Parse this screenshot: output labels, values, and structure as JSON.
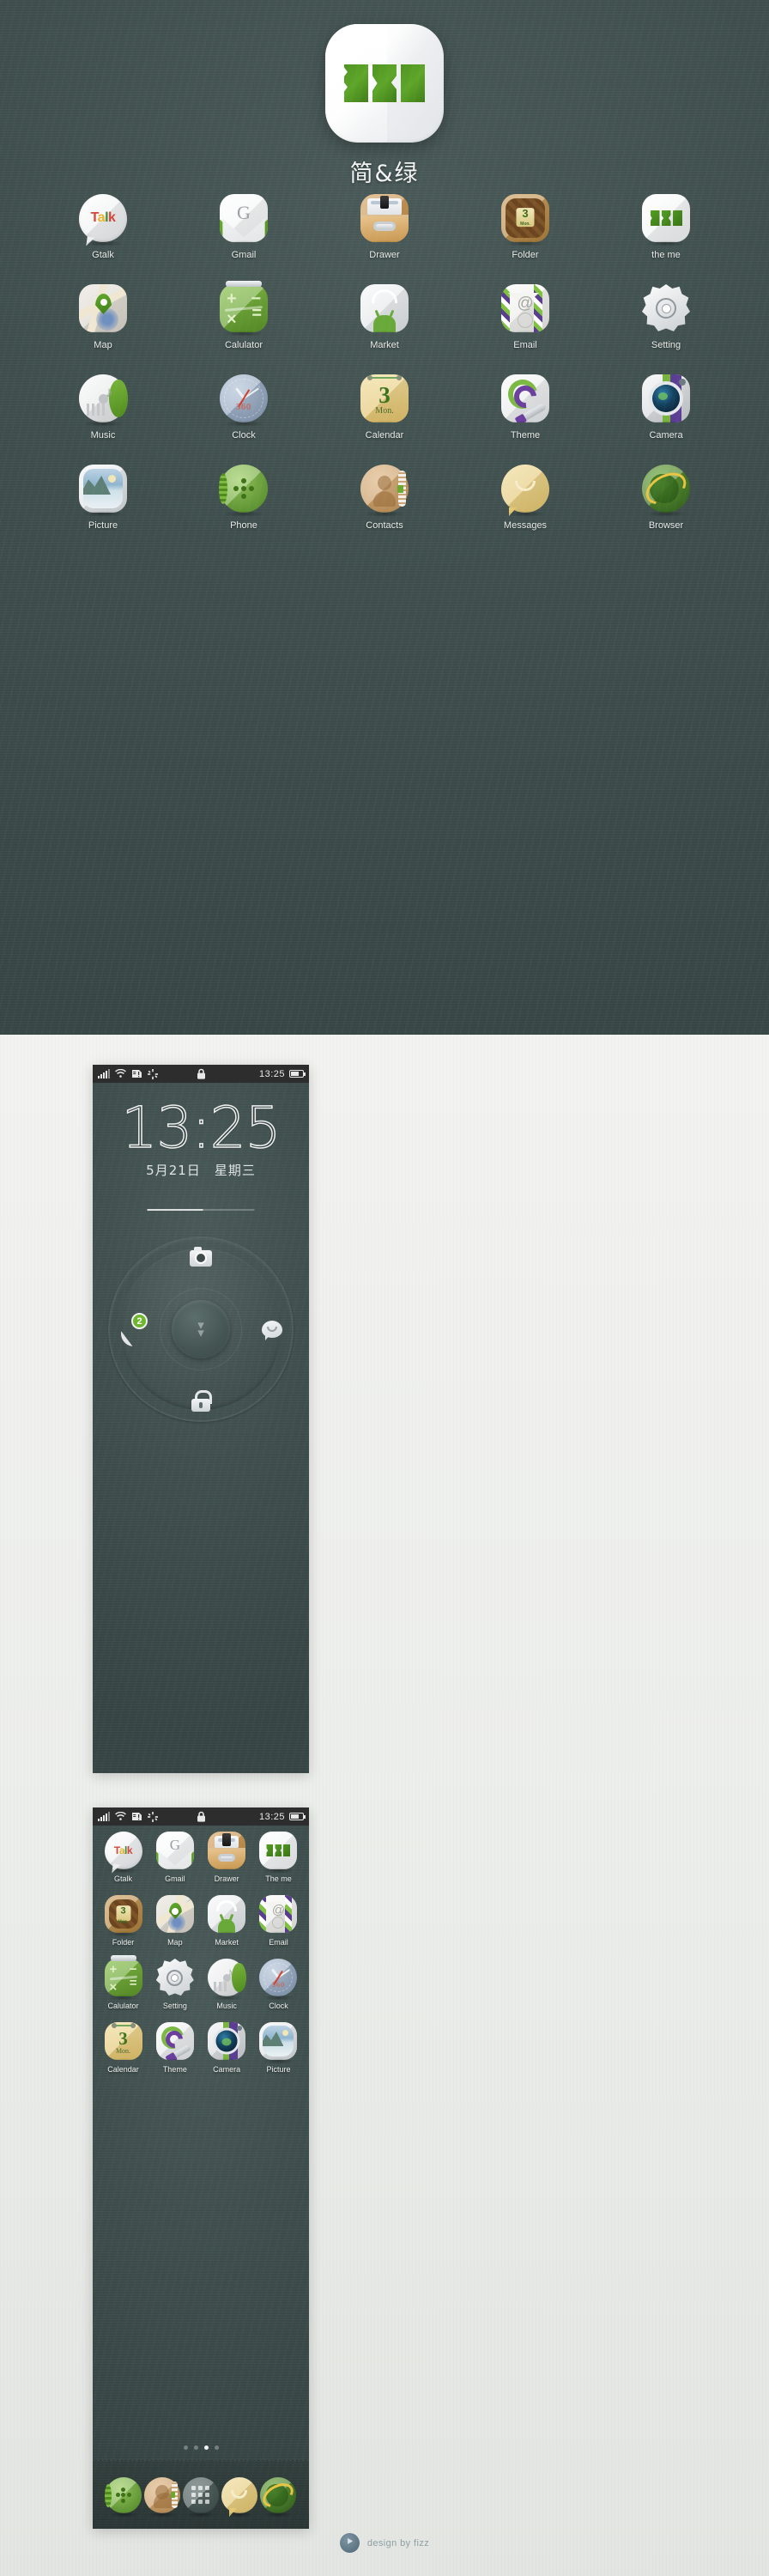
{
  "hero": {
    "app_title": "简&绿",
    "logo_icon": "jian-lv-logo-icon",
    "icon_rows": [
      [
        {
          "label": "Gtalk",
          "icon": "gtalk-icon",
          "talk": [
            "T",
            "a",
            "l",
            "k"
          ]
        },
        {
          "label": "Gmail",
          "icon": "gmail-icon",
          "letter": "G"
        },
        {
          "label": "Drawer",
          "icon": "drawer-icon"
        },
        {
          "label": "Folder",
          "icon": "folder-icon",
          "day": "3",
          "weekday": "Mon."
        },
        {
          "label": "the  me",
          "icon": "theme-logo-icon"
        }
      ],
      [
        {
          "label": "Map",
          "icon": "map-icon"
        },
        {
          "label": "Calulator",
          "icon": "calculator-icon",
          "ops": [
            "+",
            "−",
            "×",
            "="
          ]
        },
        {
          "label": "Market",
          "icon": "market-icon"
        },
        {
          "label": "Email",
          "icon": "email-icon",
          "at": "@"
        },
        {
          "label": "Setting",
          "icon": "setting-gear-icon"
        }
      ],
      [
        {
          "label": "Music",
          "icon": "music-disc-icon",
          "note": "♪"
        },
        {
          "label": "Clock",
          "icon": "clock-icon",
          "dial_text": "360"
        },
        {
          "label": "Calendar",
          "icon": "calendar-icon",
          "day": "3",
          "weekday": "Mon."
        },
        {
          "label": "Theme",
          "icon": "theme-brush-icon"
        },
        {
          "label": "Camera",
          "icon": "camera-icon"
        }
      ],
      [
        {
          "label": "Picture",
          "icon": "picture-icon"
        },
        {
          "label": "Phone",
          "icon": "phone-icon"
        },
        {
          "label": "Contacts",
          "icon": "contacts-icon"
        },
        {
          "label": "Messages",
          "icon": "messages-icon"
        },
        {
          "label": "Browser",
          "icon": "browser-globe-icon"
        }
      ]
    ]
  },
  "statusbar": {
    "signal_icon": "signal-bars-icon",
    "wifi_icon": "wifi-icon",
    "sim_icon": "sim-alert-icon",
    "sync_icon": "sync-spinner-icon",
    "lock_icon": "lock-icon",
    "time": "13:25",
    "battery_icon": "battery-icon"
  },
  "lockscreen": {
    "time": "13:25",
    "date": "5月21日",
    "weekday": "星期三",
    "ring": {
      "top": {
        "name": "camera-shortcut",
        "icon": "camera-icon"
      },
      "left": {
        "name": "phone-shortcut",
        "icon": "phone-handset-icon",
        "badge": "2"
      },
      "right": {
        "name": "messages-shortcut",
        "icon": "message-bubble-icon"
      },
      "bottom": {
        "name": "unlock-shortcut",
        "icon": "padlock-icon"
      },
      "center": {
        "name": "unlock-handle",
        "icon": "chevron-double-down-icon"
      }
    }
  },
  "drawer": {
    "rows": [
      [
        {
          "label": "Gtalk",
          "icon": "gtalk-icon",
          "talk": [
            "T",
            "a",
            "l",
            "k"
          ]
        },
        {
          "label": "Gmail",
          "icon": "gmail-icon",
          "letter": "G"
        },
        {
          "label": "Drawer",
          "icon": "drawer-icon"
        },
        {
          "label": "The me",
          "icon": "theme-logo-icon"
        }
      ],
      [
        {
          "label": "Folder",
          "icon": "folder-icon",
          "day": "3",
          "weekday": "Mon."
        },
        {
          "label": "Map",
          "icon": "map-icon"
        },
        {
          "label": "Market",
          "icon": "market-icon"
        },
        {
          "label": "Email",
          "icon": "email-icon",
          "at": "@"
        }
      ],
      [
        {
          "label": "Calulator",
          "icon": "calculator-icon",
          "ops": [
            "+",
            "−",
            "×",
            "="
          ]
        },
        {
          "label": "Setting",
          "icon": "setting-gear-icon"
        },
        {
          "label": "Music",
          "icon": "music-disc-icon",
          "note": "♪"
        },
        {
          "label": "Clock",
          "icon": "clock-icon",
          "dial_text": "360"
        }
      ],
      [
        {
          "label": "Calendar",
          "icon": "calendar-icon",
          "day": "3",
          "weekday": "Mon."
        },
        {
          "label": "Theme",
          "icon": "theme-brush-icon"
        },
        {
          "label": "Camera",
          "icon": "camera-icon"
        },
        {
          "label": "Picture",
          "icon": "picture-icon"
        }
      ]
    ],
    "page_dots": {
      "count": 4,
      "active_index": 2
    },
    "dock": [
      {
        "name": "dock-phone",
        "icon": "phone-icon"
      },
      {
        "name": "dock-contacts",
        "icon": "contacts-icon"
      },
      {
        "name": "dock-drawer",
        "icon": "drawer-grid-icon"
      },
      {
        "name": "dock-messages",
        "icon": "messages-icon"
      },
      {
        "name": "dock-browser",
        "icon": "browser-globe-icon"
      }
    ]
  },
  "footer": {
    "mark_icon": "fizz-logo-icon",
    "mark_glyph": "⯈",
    "credit": "design by fizz"
  },
  "colors": {
    "background_dark": "#3f4f4d",
    "background_light": "#eceeeb",
    "accent_green": "#6fb62e",
    "statusbar": "#2d2d2d",
    "text_light": "#eef1ef"
  }
}
